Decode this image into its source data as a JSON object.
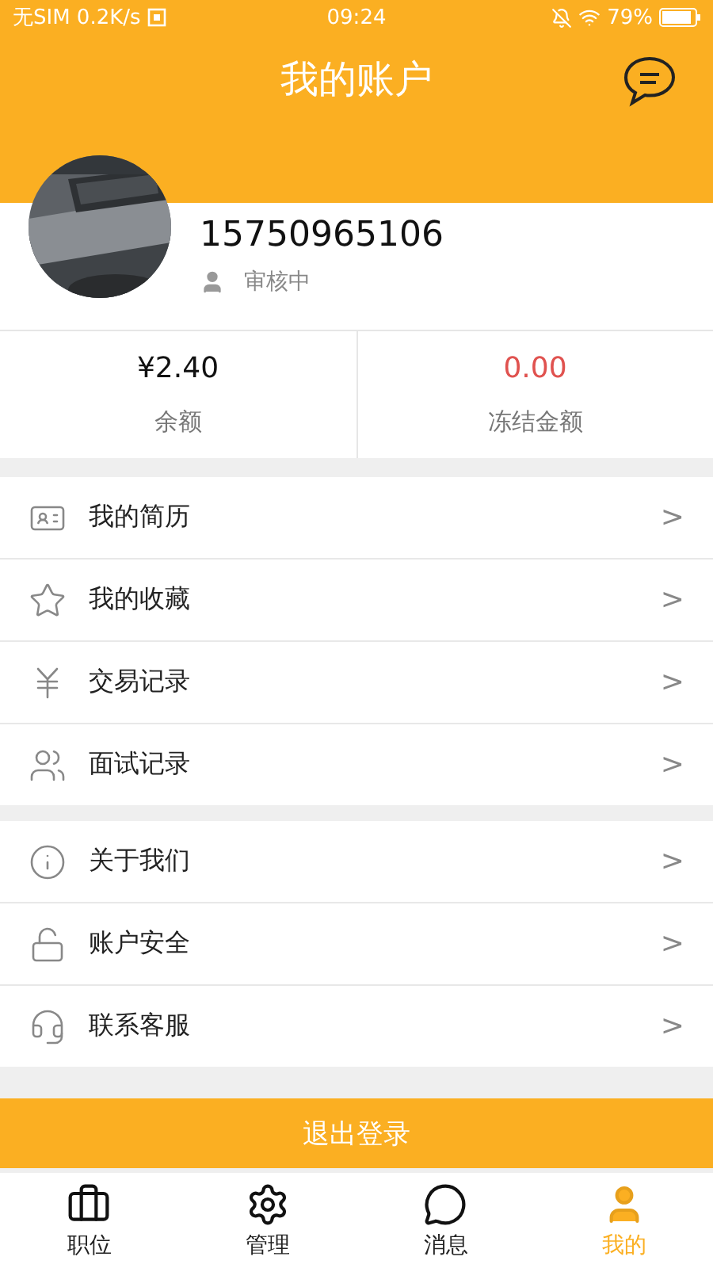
{
  "status_bar": {
    "carrier": "无SIM 0.2K/s",
    "time": "09:24",
    "battery": "79%"
  },
  "header": {
    "title": "我的账户"
  },
  "profile": {
    "phone": "15750965106",
    "status": "审核中"
  },
  "balances": [
    {
      "value": "¥2.40",
      "label": "余额",
      "color": "#111111"
    },
    {
      "value": "0.00",
      "label": "冻结金额",
      "color": "#e0524f"
    }
  ],
  "menu_groups": [
    [
      {
        "kind": "resume",
        "label": "我的简历",
        "arrow": ">"
      },
      {
        "kind": "star",
        "label": "我的收藏",
        "arrow": ">"
      },
      {
        "kind": "yen",
        "label": "交易记录",
        "arrow": ">"
      },
      {
        "kind": "people",
        "label": "面试记录",
        "arrow": ">"
      }
    ],
    [
      {
        "kind": "info",
        "label": "关于我们",
        "arrow": ">"
      },
      {
        "kind": "lock",
        "label": "账户安全",
        "arrow": ">"
      },
      {
        "kind": "headset",
        "label": "联系客服",
        "arrow": ">"
      }
    ]
  ],
  "logout_button": {
    "label": "退出登录"
  },
  "tabs": [
    {
      "kind": "briefcase",
      "label": "职位",
      "selected": false
    },
    {
      "kind": "gear",
      "label": "管理",
      "selected": false
    },
    {
      "kind": "chat",
      "label": "消息",
      "selected": false
    },
    {
      "kind": "user",
      "label": "我的",
      "selected": true
    }
  ]
}
